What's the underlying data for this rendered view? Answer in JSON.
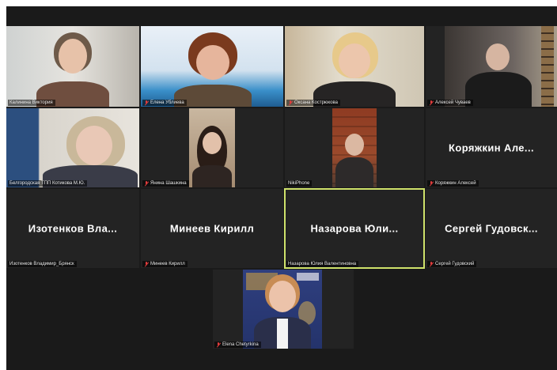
{
  "participants": [
    {
      "display_name": "Калинина Виктория",
      "muted": false
    },
    {
      "display_name": "Елена Ублиева",
      "muted": true
    },
    {
      "display_name": "Оксана Кострюкова",
      "muted": true
    },
    {
      "display_name": "Алексей Чуваев",
      "muted": true
    },
    {
      "display_name": "Белгородская ТПП Котикова М.Ю.",
      "muted": false
    },
    {
      "display_name": "Янина Шашкина",
      "muted": true
    },
    {
      "display_name": "NikiPhone",
      "muted": false
    },
    {
      "display_name": "Коряжкин Алексей",
      "muted": true,
      "big_label": "Коряжкин Але..."
    },
    {
      "display_name": "Изотенков Владимир_Брянск",
      "muted": false,
      "big_label": "Изотенков Вла..."
    },
    {
      "display_name": "Минеев Кирилл",
      "muted": true,
      "big_label": "Минеев Кирилл"
    },
    {
      "display_name": "Назарова Юлия Валентиновна",
      "muted": false,
      "big_label": "Назарова Юли...",
      "active_speaker": true
    },
    {
      "display_name": "Сергей Гудовский",
      "muted": true,
      "big_label": "Сергей Гудовск..."
    },
    {
      "display_name": "Elena Chetyrkina",
      "muted": true
    }
  ],
  "colors": {
    "active_speaker_border": "#cfe26b",
    "mute_icon": "#e23c3c",
    "grid_background": "#1a1a1a",
    "tile_background": "#232323"
  },
  "icons": {
    "mute": "mic-off-icon"
  }
}
